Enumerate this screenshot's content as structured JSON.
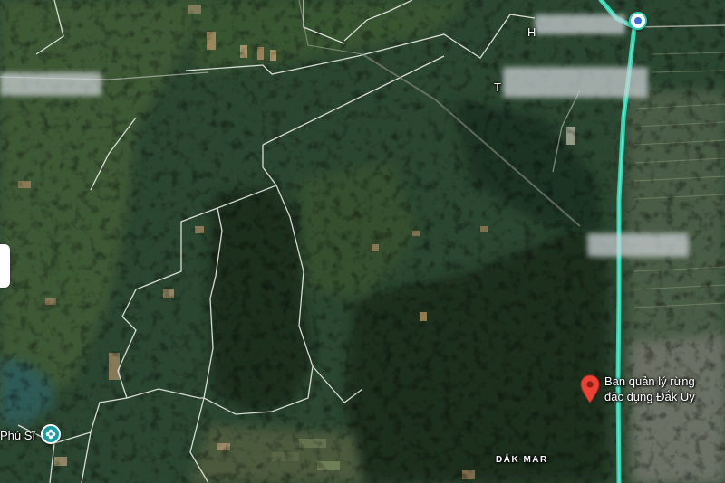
{
  "map": {
    "map_type": "satellite",
    "route_color": "#30d6b4",
    "marker_color": "#ea4335",
    "poi_color": "#1a9ea3"
  },
  "labels": {
    "forest_office": [
      "Ban quản lý rừng",
      "đặc dụng Đắk Uy"
    ],
    "area": "ĐẮK MAR",
    "phu_si": "Phú Sĩ",
    "partial_h": "H",
    "partial_t": "T"
  },
  "icons": {
    "selected_place": "red-location-pin",
    "poi": "flower-icon",
    "route_point": "circle-marker"
  },
  "redactions": "pixelated labels"
}
